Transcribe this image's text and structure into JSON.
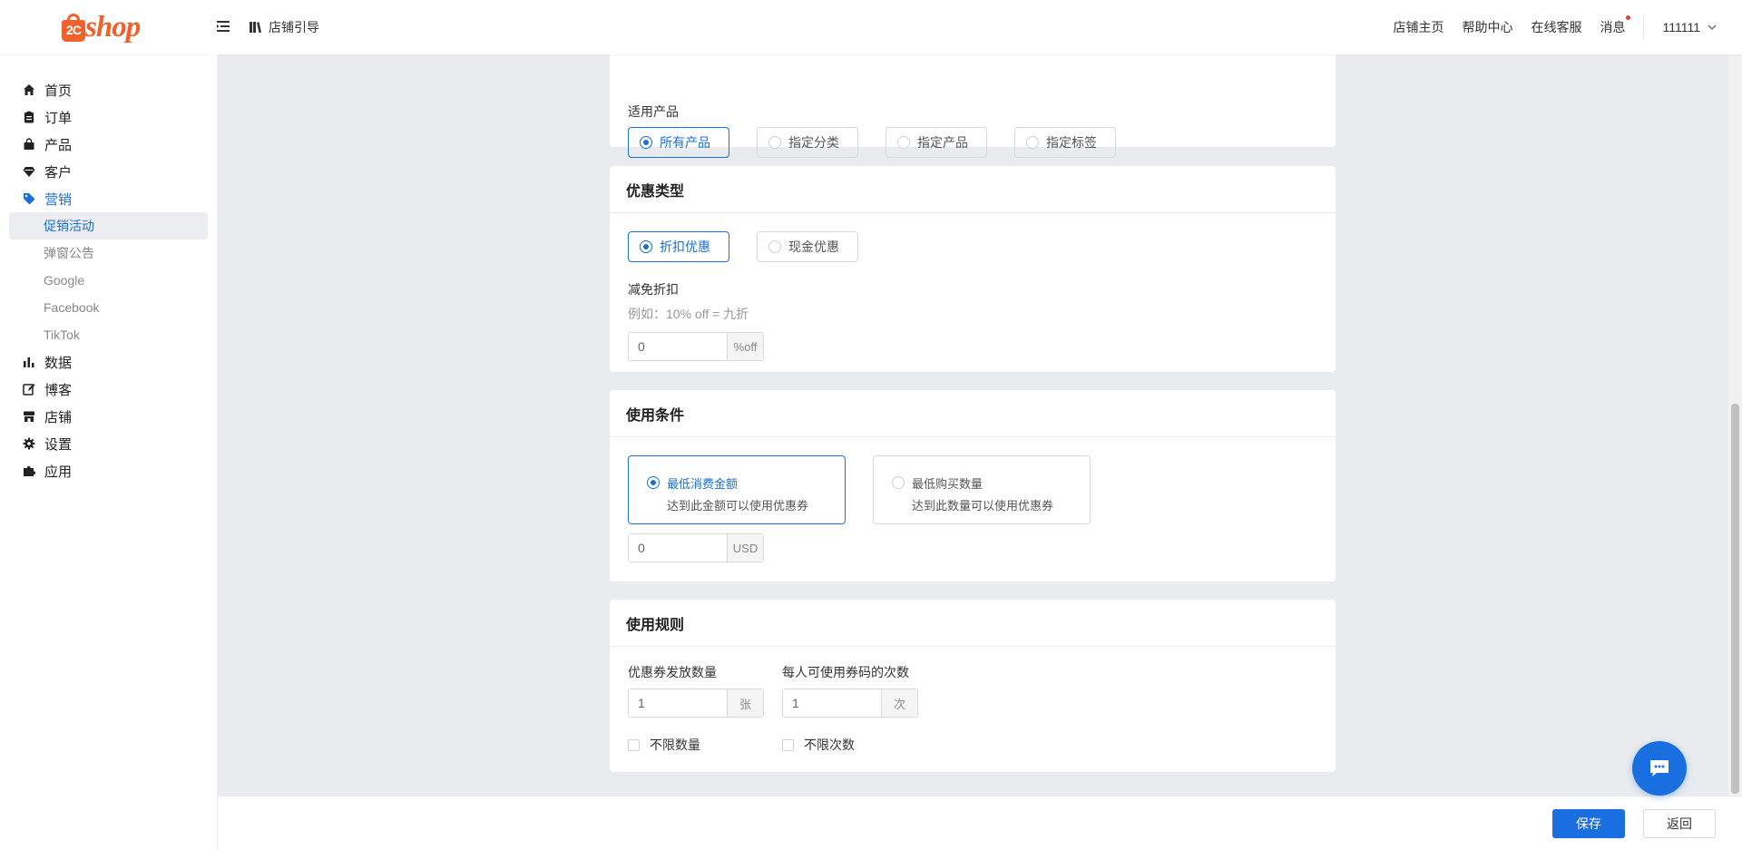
{
  "header": {
    "logo_mark": "2C",
    "logo_text": "shop",
    "guide_label": "店铺引导",
    "links": [
      "店铺主页",
      "帮助中心",
      "在线客服"
    ],
    "message_label": "消息",
    "username": "111111"
  },
  "sidebar": {
    "items": [
      {
        "label": "首页",
        "icon": "home-icon"
      },
      {
        "label": "订单",
        "icon": "clipboard-icon"
      },
      {
        "label": "产品",
        "icon": "bag-icon"
      },
      {
        "label": "客户",
        "icon": "diamond-icon"
      },
      {
        "label": "营销",
        "icon": "tag-icon"
      },
      {
        "label": "数据",
        "icon": "bar-chart-icon"
      },
      {
        "label": "博客",
        "icon": "edit-icon"
      },
      {
        "label": "店铺",
        "icon": "store-icon"
      },
      {
        "label": "设置",
        "icon": "gear-icon"
      },
      {
        "label": "应用",
        "icon": "puzzle-icon"
      }
    ],
    "marketing_sub": [
      "促销活动",
      "弹窗公告",
      "Google",
      "Facebook",
      "TikTok"
    ]
  },
  "applicable": {
    "label": "适用产品",
    "options": [
      "所有产品",
      "指定分类",
      "指定产品",
      "指定标签"
    ],
    "selected": "所有产品"
  },
  "discount_type": {
    "title": "优惠类型",
    "options": [
      "折扣优惠",
      "现金优惠"
    ],
    "selected": "折扣优惠",
    "field_label": "减免折扣",
    "hint": "例如：10% off = 九折",
    "value": "0",
    "suffix": "%off"
  },
  "conditions": {
    "title": "使用条件",
    "options": [
      {
        "title": "最低消费金额",
        "desc": "达到此金额可以使用优惠券"
      },
      {
        "title": "最低购买数量",
        "desc": "达到此数量可以使用优惠券"
      }
    ],
    "selected": "最低消费金额",
    "value": "0",
    "suffix": "USD"
  },
  "rules": {
    "title": "使用规则",
    "quantity_label": "优惠券发放数量",
    "quantity_value": "1",
    "quantity_suffix": "张",
    "quantity_unlimited": "不限数量",
    "per_user_label": "每人可使用券码的次数",
    "per_user_value": "1",
    "per_user_suffix": "次",
    "per_user_unlimited": "不限次数"
  },
  "footer": {
    "save_label": "保存",
    "back_label": "返回"
  },
  "colors": {
    "accent": "#1a6fe0",
    "brand": "#f0612b"
  }
}
